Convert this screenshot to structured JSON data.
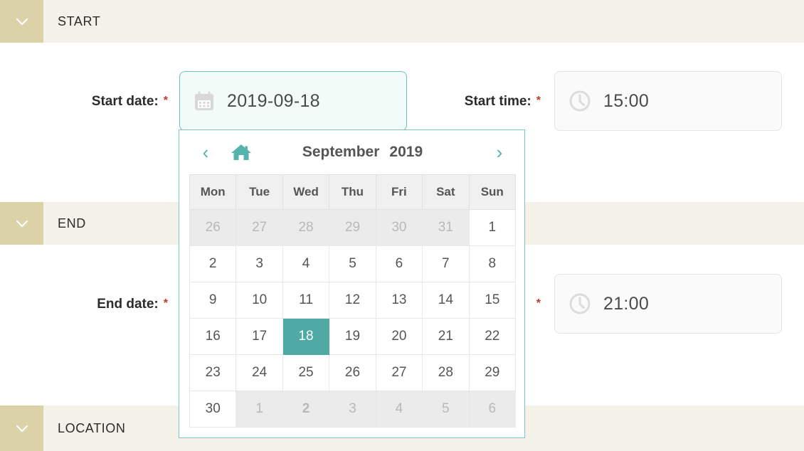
{
  "sections": [
    {
      "id": "start",
      "title": "START",
      "toggle_icon": "chevron-down-icon"
    },
    {
      "id": "end",
      "title": "END",
      "toggle_icon": "chevron-down-icon"
    },
    {
      "id": "location",
      "title": "LOCATION",
      "toggle_icon": "chevron-down-icon"
    }
  ],
  "fields": {
    "start_date": {
      "label": "Start date:",
      "required_marker": "*",
      "value": "2019-09-18",
      "icon": "calendar-icon",
      "focused": true
    },
    "start_time": {
      "label": "Start time:",
      "required_marker": "*",
      "value": "15:00",
      "icon": "clock-icon",
      "focused": false
    },
    "end_date": {
      "label": "End date:",
      "required_marker": "*",
      "value": "",
      "icon": "calendar-icon",
      "focused": false
    },
    "end_time": {
      "label": "",
      "required_marker": "*",
      "value": "21:00",
      "icon": "clock-icon",
      "focused": false
    }
  },
  "datepicker": {
    "prev_label": "‹",
    "next_label": "›",
    "home_icon": "home-icon",
    "month": "September",
    "year": "2019",
    "weekdays": [
      "Mon",
      "Tue",
      "Wed",
      "Thu",
      "Fri",
      "Sat",
      "Sun"
    ],
    "weeks": [
      [
        {
          "day": "26",
          "state": "other"
        },
        {
          "day": "27",
          "state": "other"
        },
        {
          "day": "28",
          "state": "other"
        },
        {
          "day": "29",
          "state": "other"
        },
        {
          "day": "30",
          "state": "other"
        },
        {
          "day": "31",
          "state": "other"
        },
        {
          "day": "1",
          "state": "current"
        }
      ],
      [
        {
          "day": "2",
          "state": "current"
        },
        {
          "day": "3",
          "state": "current"
        },
        {
          "day": "4",
          "state": "current"
        },
        {
          "day": "5",
          "state": "current"
        },
        {
          "day": "6",
          "state": "current"
        },
        {
          "day": "7",
          "state": "current"
        },
        {
          "day": "8",
          "state": "current"
        }
      ],
      [
        {
          "day": "9",
          "state": "current"
        },
        {
          "day": "10",
          "state": "current"
        },
        {
          "day": "11",
          "state": "current"
        },
        {
          "day": "12",
          "state": "current"
        },
        {
          "day": "13",
          "state": "current"
        },
        {
          "day": "14",
          "state": "current"
        },
        {
          "day": "15",
          "state": "current"
        }
      ],
      [
        {
          "day": "16",
          "state": "current"
        },
        {
          "day": "17",
          "state": "current"
        },
        {
          "day": "18",
          "state": "selected"
        },
        {
          "day": "19",
          "state": "current"
        },
        {
          "day": "20",
          "state": "current"
        },
        {
          "day": "21",
          "state": "current"
        },
        {
          "day": "22",
          "state": "current"
        }
      ],
      [
        {
          "day": "23",
          "state": "current"
        },
        {
          "day": "24",
          "state": "current"
        },
        {
          "day": "25",
          "state": "current"
        },
        {
          "day": "26",
          "state": "current"
        },
        {
          "day": "27",
          "state": "current"
        },
        {
          "day": "28",
          "state": "current"
        },
        {
          "day": "29",
          "state": "current"
        }
      ],
      [
        {
          "day": "30",
          "state": "current"
        },
        {
          "day": "1",
          "state": "other"
        },
        {
          "day": "2",
          "state": "other today"
        },
        {
          "day": "3",
          "state": "other"
        },
        {
          "day": "4",
          "state": "other"
        },
        {
          "day": "5",
          "state": "other"
        },
        {
          "day": "6",
          "state": "other"
        }
      ]
    ],
    "selected_day": "18"
  },
  "colors": {
    "accent_teal": "#4fa9a5",
    "section_toggle": "#dbd2a8",
    "section_band": "#f4f1e9",
    "required_red": "#c0392b",
    "focus_border": "#6ec1bd"
  }
}
